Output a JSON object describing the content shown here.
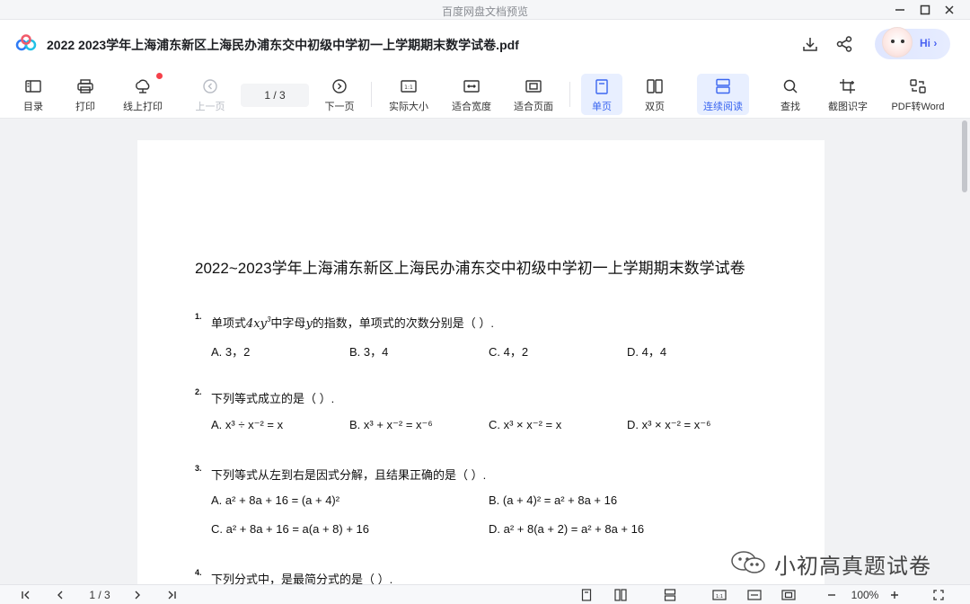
{
  "window": {
    "title": "百度网盘文档预览"
  },
  "header": {
    "document_title": "2022 2023学年上海浦东新区上海民办浦东交中初级中学初一上学期期末数学试卷.pdf",
    "assistant_label": "Hi"
  },
  "toolbar": {
    "items": {
      "toc": "目录",
      "print": "打印",
      "online_print": "线上打印",
      "prev_page": "上一页",
      "next_page": "下一页",
      "actual_size": "实际大小",
      "fit_width": "适合宽度",
      "fit_page": "适合页面",
      "single_page": "单页",
      "double_page": "双页",
      "continuous": "连续阅读",
      "find": "查找",
      "screenshot_ocr": "截图识字",
      "pdf_to_word": "PDF转Word"
    },
    "page_indicator": "1 / 3"
  },
  "document": {
    "title": "2022~2023学年上海浦东新区上海民办浦东交中初级中学初一上学期期末数学试卷",
    "questions": [
      {
        "num": "1.",
        "text_pre": "单项式",
        "expr": "4xy",
        "sup": "3",
        "text_mid": "中字母",
        "var": "y",
        "text_post": "的指数，单项式的次数分别是（   ）.",
        "options": [
          "A. 3，2",
          "B. 3，4",
          "C. 4，2",
          "D. 4，4"
        ]
      },
      {
        "num": "2.",
        "text": "下列等式成立的是（   ）.",
        "options": [
          "A. x³ ÷ x⁻² = x",
          "B. x³ + x⁻² = x⁻⁶",
          "C. x³ × x⁻² = x",
          "D. x³ × x⁻² = x⁻⁶"
        ]
      },
      {
        "num": "3.",
        "text": "下列等式从左到右是因式分解，且结果正确的是（   ）.",
        "options": [
          "A. a² + 8a + 16 = (a + 4)²",
          "B. (a + 4)² = a² + 8a + 16",
          "C. a² + 8a + 16 = a(a + 8) + 16",
          "D. a² + 8(a + 2) = a² + 8a + 16"
        ]
      },
      {
        "num": "4.",
        "text": "下列分式中，是最简分式的是（   ）."
      }
    ]
  },
  "watermark": "小初高真题试卷",
  "bottombar": {
    "page_indicator": "1 / 3",
    "zoom": "100%"
  },
  "colors": {
    "accent": "#3a66f0",
    "active_bg": "#e8efff",
    "badge": "#f5414a"
  }
}
